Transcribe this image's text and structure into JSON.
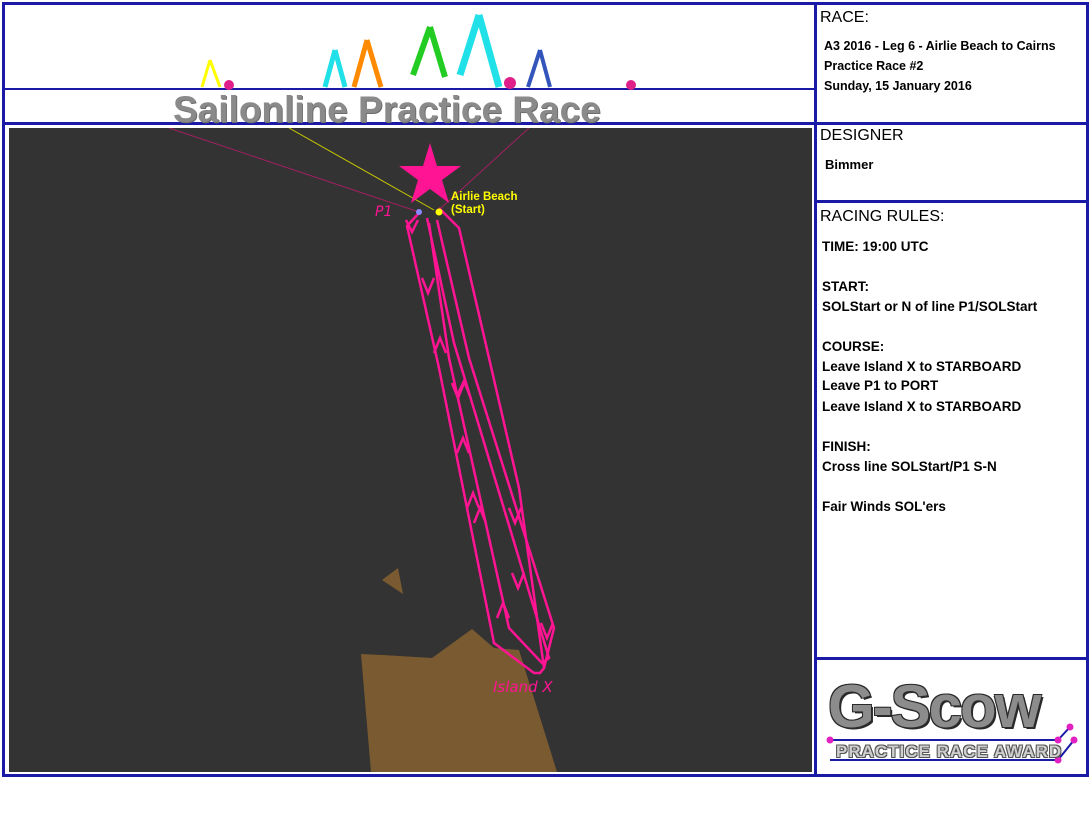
{
  "banner": {
    "title": "Sailonline Practice Race"
  },
  "race": {
    "heading": "RACE:",
    "lines": [
      "A3 2016 - Leg 6 - Airlie Beach to Cairns",
      "Practice Race #2",
      "Sunday, 15 January 2016"
    ]
  },
  "designer": {
    "heading": "DESIGNER",
    "name": "Bimmer"
  },
  "rules": {
    "heading": "RACING RULES:",
    "time": "TIME: 19:00 UTC",
    "start_heading": "START:",
    "start_text": "SOLStart or N of line P1/SOLStart",
    "course_heading": "COURSE:",
    "course_lines": [
      "Leave Island X to STARBOARD",
      "Leave P1 to PORT",
      "Leave Island X to STARBOARD"
    ],
    "finish_heading": "FINISH:",
    "finish_text": "Cross line SOLStart/P1 S-N",
    "closing": "Fair Winds SOL'ers"
  },
  "map": {
    "start_label_line1": "Airlie Beach",
    "start_label_line2": "(Start)",
    "p1_label": "P1",
    "island_label": "Island X"
  },
  "award": {
    "main": "G-Scow",
    "sub": "PRACTICE RACE AWARD"
  },
  "colors": {
    "frame": "#1a1aa6",
    "route": "#ff1493",
    "start_marker": "#ffff00",
    "sea": "#333333",
    "land": "#7a5a30",
    "banner_text": "#8a8a8a"
  }
}
